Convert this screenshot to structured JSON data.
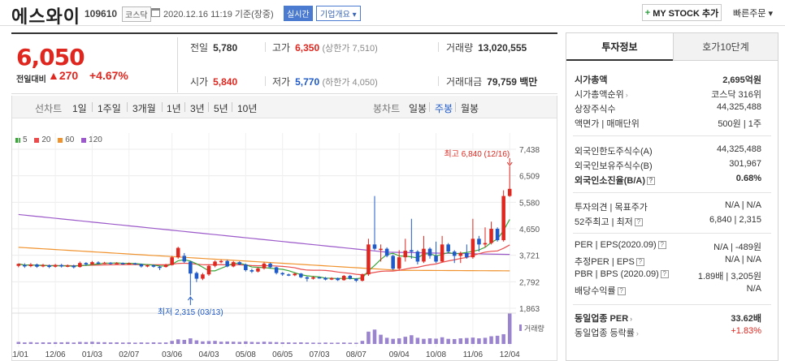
{
  "header": {
    "stock_name": "에스와이",
    "stock_code": "109610",
    "market": "코스닥",
    "datetime": "2020.12.16 11:19 기준(장중)",
    "realtime_badge": "실시간",
    "company_badge": "기업개요",
    "mystock_plus": "+",
    "mystock_label": "MY STOCK 추가",
    "quick_order": "빠른주문"
  },
  "price": {
    "current": "6,050",
    "change_label": "전일대비",
    "change_value": "270",
    "change_pct": "+4.67%"
  },
  "stats": {
    "prev_label": "전일",
    "prev": "5,780",
    "high_label": "고가",
    "high": "6,350",
    "high_limit": "(상한가 7,510)",
    "volume_label": "거래량",
    "volume": "13,020,555",
    "open_label": "시가",
    "open": "5,840",
    "low_label": "저가",
    "low": "5,770",
    "low_limit": "(하한가 4,050)",
    "amount_label": "거래대금",
    "amount": "79,759 백만"
  },
  "period_bar": {
    "line_label": "선차트",
    "periods": [
      "1일",
      "1주일",
      "3개월",
      "1년",
      "3년",
      "5년",
      "10년"
    ],
    "candle_label": "봉차트",
    "candle_periods": [
      "일봉",
      "주봉",
      "월봉"
    ]
  },
  "ma_legend": [
    {
      "label": "5",
      "color": "#3aa538"
    },
    {
      "label": "20",
      "color": "#e94c4c"
    },
    {
      "label": "60",
      "color": "#f0932e"
    },
    {
      "label": "120",
      "color": "#9b59c9"
    }
  ],
  "chart_annotations": {
    "max_label": "최고 6,840 (12/16)",
    "min_label": "최저 2,315 (03/13)",
    "volume_label": "거래량"
  },
  "chart_data": {
    "type": "candlestick",
    "y_ticks": [
      7438,
      6509,
      5580,
      4650,
      3721,
      2792,
      1863
    ],
    "ylim": [
      1863,
      7438
    ],
    "x_ticks": [
      "11/01",
      "12/06",
      "01/03",
      "02/07",
      "03/06",
      "04/03",
      "05/08",
      "06/05",
      "07/03",
      "08/07",
      "09/04",
      "10/08",
      "11/06",
      "12/04"
    ],
    "high": {
      "value": 6840,
      "date": "12/16"
    },
    "low": {
      "value": 2315,
      "date": "03/13"
    },
    "candles": [
      [
        3350,
        3420,
        3300,
        3430,
        "u"
      ],
      [
        3380,
        3330,
        3280,
        3440,
        "d"
      ],
      [
        3340,
        3400,
        3300,
        3450,
        "u"
      ],
      [
        3400,
        3320,
        3280,
        3430,
        "d"
      ],
      [
        3330,
        3380,
        3300,
        3420,
        "u"
      ],
      [
        3370,
        3310,
        3270,
        3400,
        "d"
      ],
      [
        3320,
        3380,
        3290,
        3420,
        "u"
      ],
      [
        3380,
        3330,
        3290,
        3420,
        "d"
      ],
      [
        3340,
        3360,
        3300,
        3400,
        "u"
      ],
      [
        3360,
        3300,
        3260,
        3390,
        "d"
      ],
      [
        3310,
        3450,
        3290,
        3500,
        "u"
      ],
      [
        3450,
        3400,
        3360,
        3480,
        "d"
      ],
      [
        3400,
        3480,
        3380,
        3520,
        "u"
      ],
      [
        3470,
        3440,
        3410,
        3510,
        "d"
      ],
      [
        3440,
        3460,
        3420,
        3490,
        "u"
      ],
      [
        3460,
        3430,
        3400,
        3480,
        "d"
      ],
      [
        3430,
        3450,
        3410,
        3480,
        "u"
      ],
      [
        3450,
        3420,
        3390,
        3470,
        "d"
      ],
      [
        3420,
        3440,
        3400,
        3470,
        "u"
      ],
      [
        3440,
        3410,
        3380,
        3460,
        "d"
      ],
      [
        3410,
        3330,
        3290,
        3430,
        "d"
      ],
      [
        3330,
        3370,
        3300,
        3400,
        "u"
      ],
      [
        3370,
        3320,
        3290,
        3400,
        "d"
      ],
      [
        3320,
        3310,
        3200,
        3350,
        "d"
      ],
      [
        3310,
        3380,
        3290,
        3420,
        "u"
      ],
      [
        3380,
        3650,
        3360,
        3700,
        "u"
      ],
      [
        3650,
        3980,
        3600,
        4020,
        "u"
      ],
      [
        3700,
        3500,
        3450,
        3800,
        "d"
      ],
      [
        3500,
        3080,
        2315,
        3520,
        "d"
      ],
      [
        3100,
        2900,
        2780,
        3150,
        "d"
      ],
      [
        2900,
        3050,
        2850,
        3100,
        "u"
      ],
      [
        3050,
        3350,
        3000,
        3400,
        "u"
      ],
      [
        3350,
        3500,
        3300,
        3540,
        "u"
      ],
      [
        3500,
        3520,
        3440,
        3560,
        "u"
      ],
      [
        3520,
        3330,
        3300,
        3560,
        "d"
      ],
      [
        3330,
        3480,
        3300,
        3520,
        "u"
      ],
      [
        3480,
        3400,
        3370,
        3510,
        "d"
      ],
      [
        3400,
        3200,
        3150,
        3430,
        "d"
      ],
      [
        3200,
        3150,
        3100,
        3250,
        "d"
      ],
      [
        3150,
        3260,
        3120,
        3300,
        "u"
      ],
      [
        3260,
        3430,
        3220,
        3470,
        "u"
      ],
      [
        3430,
        3300,
        3260,
        3460,
        "d"
      ],
      [
        3300,
        3100,
        3050,
        3320,
        "d"
      ],
      [
        3100,
        3050,
        3000,
        3130,
        "d"
      ],
      [
        3050,
        3020,
        2990,
        3080,
        "d"
      ],
      [
        3020,
        3080,
        2990,
        3100,
        "u"
      ],
      [
        3080,
        2950,
        2920,
        3100,
        "d"
      ],
      [
        2950,
        2900,
        2800,
        2980,
        "d"
      ],
      [
        2900,
        2950,
        2870,
        2990,
        "u"
      ],
      [
        2950,
        2930,
        2900,
        2970,
        "d"
      ],
      [
        2930,
        2870,
        2840,
        2960,
        "d"
      ],
      [
        2870,
        2920,
        2850,
        2950,
        "u"
      ],
      [
        2920,
        2850,
        2820,
        2940,
        "d"
      ],
      [
        2850,
        3000,
        2830,
        3030,
        "u"
      ],
      [
        3000,
        2900,
        2870,
        3030,
        "d"
      ],
      [
        2900,
        2830,
        2780,
        2920,
        "d"
      ],
      [
        2830,
        3050,
        2800,
        3080,
        "u"
      ],
      [
        3050,
        4100,
        3000,
        4300,
        "u"
      ],
      [
        4100,
        3950,
        3900,
        5800,
        "d"
      ],
      [
        3950,
        3950,
        3500,
        4100,
        "u"
      ],
      [
        3950,
        3700,
        3650,
        4000,
        "d"
      ],
      [
        3700,
        3250,
        3200,
        3750,
        "d"
      ],
      [
        3250,
        3650,
        3200,
        3900,
        "u"
      ],
      [
        3650,
        3880,
        3500,
        4300,
        "u"
      ],
      [
        3900,
        3850,
        3600,
        5000,
        "d"
      ],
      [
        3850,
        3500,
        3400,
        3900,
        "d"
      ],
      [
        3500,
        3950,
        3450,
        4400,
        "u"
      ],
      [
        3950,
        3700,
        3600,
        4000,
        "d"
      ],
      [
        3700,
        3500,
        3450,
        4200,
        "d"
      ],
      [
        3500,
        4100,
        3480,
        4400,
        "u"
      ],
      [
        4100,
        3850,
        3800,
        4150,
        "d"
      ],
      [
        3850,
        3700,
        3450,
        3900,
        "d"
      ],
      [
        3700,
        3800,
        3450,
        3850,
        "u"
      ],
      [
        3800,
        3650,
        3600,
        4100,
        "d"
      ],
      [
        3650,
        4300,
        3600,
        5000,
        "u"
      ],
      [
        4300,
        4100,
        3850,
        4400,
        "d"
      ],
      [
        4100,
        4150,
        4000,
        4700,
        "u"
      ],
      [
        4150,
        4650,
        4100,
        4900,
        "u"
      ],
      [
        4650,
        4250,
        4200,
        4700,
        "d"
      ],
      [
        4250,
        5800,
        4200,
        6000,
        "u"
      ],
      [
        5800,
        6050,
        5770,
        6840,
        "u"
      ]
    ],
    "volume": [
      20,
      15,
      18,
      14,
      16,
      15,
      17,
      16,
      18,
      14,
      20,
      18,
      22,
      18,
      17,
      15,
      16,
      14,
      15,
      13,
      15,
      14,
      16,
      14,
      15,
      30,
      45,
      40,
      55,
      35,
      25,
      28,
      30,
      22,
      24,
      22,
      20,
      25,
      20,
      18,
      22,
      20,
      18,
      16,
      15,
      14,
      16,
      14,
      13,
      12,
      14,
      12,
      13,
      14,
      12,
      12,
      30,
      120,
      140,
      90,
      60,
      50,
      55,
      70,
      85,
      60,
      50,
      55,
      52,
      65,
      50,
      48,
      55,
      58,
      62,
      55,
      60,
      75,
      80,
      95,
      300
    ]
  },
  "right_panel": {
    "tab_active": "투자정보",
    "tab_inactive": "호가10단계",
    "rows1": [
      {
        "k": "시가총액",
        "v": "2,695억원"
      },
      {
        "k": "시가총액순위",
        "v": "코스닥 316위"
      },
      {
        "k": "상장주식수",
        "v": "44,325,488"
      },
      {
        "k": "액면가 | 매매단위",
        "v": "500원 | 1주"
      }
    ],
    "rows2": [
      {
        "k": "외국인한도주식수(A)",
        "v": "44,325,488"
      },
      {
        "k": "외국인보유주식수(B)",
        "v": "301,967"
      },
      {
        "k": "외국인소진율(B/A)",
        "v": "0.68%"
      }
    ],
    "rows3": [
      {
        "k": "투자의견 | 목표주가",
        "v": "N/A | N/A"
      },
      {
        "k": "52주최고 | 최저",
        "v": "6,840 | 2,315"
      }
    ],
    "rows4": [
      {
        "k": "PER | EPS(2020.09)",
        "v": "N/A | -489원"
      },
      {
        "k": "추정PER | EPS",
        "v": "N/A | N/A"
      },
      {
        "k": "PBR | BPS (2020.09)",
        "v": "1.89배 | 3,205원"
      },
      {
        "k": "배당수익률",
        "v": "N/A"
      }
    ],
    "rows5": [
      {
        "k": "동일업종 PER",
        "v": "33.62배"
      },
      {
        "k": "동일업종 등락률",
        "v": "+1.83%"
      }
    ]
  },
  "colors": {
    "up": "#e0271f",
    "down": "#1f5ac8",
    "accent": "#4a7bd0"
  }
}
